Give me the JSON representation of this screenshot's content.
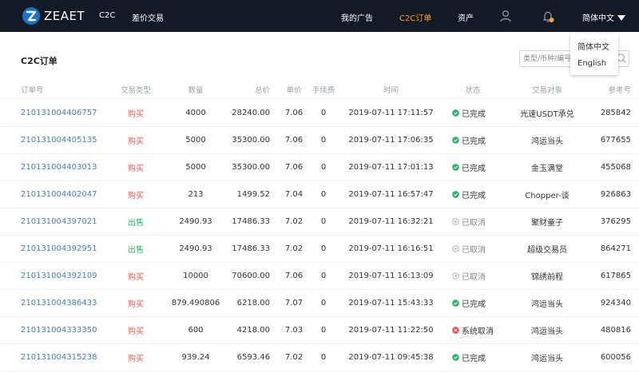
{
  "nav": {
    "brand": "ZEAET",
    "links": [
      "C2C",
      "差价交易"
    ],
    "right_links": [
      "我的广告",
      "C2C订单",
      "资产"
    ],
    "language": "简体中文",
    "language_options": [
      "简体中文",
      "English"
    ],
    "accent_color": "#f5a623"
  },
  "page": {
    "title": "C2C订单",
    "search_placeholder": "类型/币种/编号"
  },
  "table": {
    "columns": [
      "订单号",
      "交易类型",
      "数量",
      "总价",
      "单价",
      "手续费",
      "时间",
      "状态",
      "交易对象",
      "参考号"
    ],
    "rows": [
      {
        "order": "210131004406757",
        "type": "购买",
        "qty": "4000",
        "total": "28240.00",
        "price": "7.06",
        "fee": "0",
        "time": "2019-07-11 17:11:57",
        "status": "已完成",
        "party": "光速USDT承兑",
        "ref": "285842"
      },
      {
        "order": "210131004405135",
        "type": "购买",
        "qty": "5000",
        "total": "35300.00",
        "price": "7.06",
        "fee": "0",
        "time": "2019-07-11 17:06:35",
        "status": "已完成",
        "party": "鸿运当头",
        "ref": "677655"
      },
      {
        "order": "210131004403013",
        "type": "购买",
        "qty": "5000",
        "total": "35300.00",
        "price": "7.06",
        "fee": "0",
        "time": "2019-07-11 17:01:13",
        "status": "已完成",
        "party": "金玉满堂",
        "ref": "455068"
      },
      {
        "order": "210131004402047",
        "type": "购买",
        "qty": "213",
        "total": "1499.52",
        "price": "7.04",
        "fee": "0",
        "time": "2019-07-11 16:57:47",
        "status": "已完成",
        "party": "Chopper-谈",
        "ref": "926863"
      },
      {
        "order": "210131004397021",
        "type": "出售",
        "qty": "2490.93",
        "total": "17486.33",
        "price": "7.02",
        "fee": "0",
        "time": "2019-07-11 16:32:21",
        "status": "已取消",
        "party": "聚财童子",
        "ref": "376295"
      },
      {
        "order": "210131004392951",
        "type": "出售",
        "qty": "2490.93",
        "total": "17486.33",
        "price": "7.02",
        "fee": "0",
        "time": "2019-07-11 16:16:51",
        "status": "已取消",
        "party": "超级交易员",
        "ref": "864271"
      },
      {
        "order": "210131004392109",
        "type": "购买",
        "qty": "10000",
        "total": "70600.00",
        "price": "7.06",
        "fee": "0",
        "time": "2019-07-11 16:13:09",
        "status": "已取消",
        "party": "锦绣前程",
        "ref": "617865"
      },
      {
        "order": "210131004386433",
        "type": "购买",
        "qty": "879.490806",
        "total": "6218.00",
        "price": "7.07",
        "fee": "0",
        "time": "2019-07-11 15:43:33",
        "status": "已完成",
        "party": "鸿运当头",
        "ref": "924340"
      },
      {
        "order": "210131004333350",
        "type": "购买",
        "qty": "600",
        "total": "4218.00",
        "price": "7.03",
        "fee": "0",
        "time": "2019-07-11 11:22:50",
        "status": "系统取消",
        "party": "鸿运当头",
        "ref": "480816"
      },
      {
        "order": "210131004315238",
        "type": "购买",
        "qty": "939.24",
        "total": "6593.46",
        "price": "7.02",
        "fee": "0",
        "time": "2019-07-11 09:45:38",
        "status": "已完成",
        "party": "鸿运当头",
        "ref": "600056"
      }
    ]
  },
  "colors": {
    "buy": "#e8544e",
    "sell": "#2db36a",
    "done": "#2db36a",
    "cancelled": "#9aa3ad",
    "system_cancel": "#e8544e",
    "link": "#3f80c4"
  }
}
